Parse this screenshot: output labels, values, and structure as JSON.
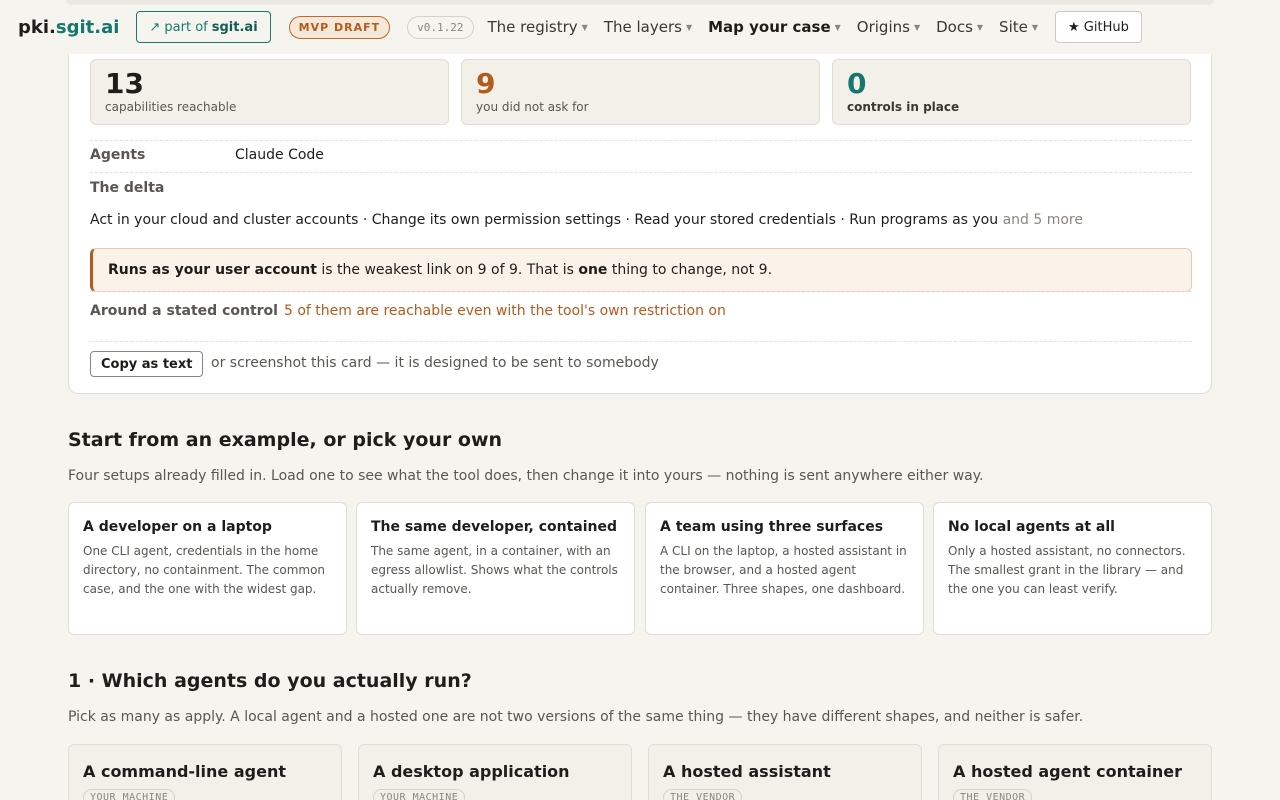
{
  "nav": {
    "brand_prefix": "pki.",
    "brand_domain": "sgit.ai",
    "partof_prefix": "↗ part of",
    "partof_site": "sgit.ai",
    "badge_status": "MVP DRAFT",
    "badge_version": "v0.1.22",
    "links": [
      "The registry",
      "The layers",
      "Map your case",
      "Origins",
      "Docs",
      "Site"
    ],
    "active_link": "Map your case",
    "github_label": "★ GitHub"
  },
  "result": {
    "stats": [
      {
        "value": "13",
        "label": "capabilities reachable",
        "color": "#1f1d1a"
      },
      {
        "value": "9",
        "label": "you did not ask for",
        "color": "#b45a1e"
      },
      {
        "value": "0",
        "label": "controls in place",
        "color": "#16786d"
      }
    ],
    "agents_label": "Agents",
    "agents_value": "Claude Code",
    "delta_label": "The delta",
    "delta_items": "Act in your cloud and cluster accounts · Change its own permission settings · Read your stored credentials · Run programs as you",
    "delta_more": "and 5 more",
    "callout": {
      "bold_lead": "Runs as your user account",
      "middle": "is the weakest link on 9 of 9. That is",
      "bold_one": "one",
      "tail": "thing to change, not 9."
    },
    "control_label": "Around a stated control",
    "control_value": "5 of them are reachable even with the tool's own restriction on",
    "copy_button": "Copy as text",
    "copy_hint": "or screenshot this card — it is designed to be sent to somebody"
  },
  "examples": {
    "title": "Start from an example, or pick your own",
    "lead": "Four setups already filled in. Load one to see what the tool does, then change it into yours — nothing is sent anywhere either way.",
    "cards": [
      {
        "title": "A developer on a laptop",
        "desc": "One CLI agent, credentials in the home directory, no containment. The common case, and the one with the widest gap."
      },
      {
        "title": "The same developer, contained",
        "desc": "The same agent, in a container, with an egress allowlist. Shows what the controls actually remove."
      },
      {
        "title": "A team using three surfaces",
        "desc": "A CLI on the laptop, a hosted assistant in the browser, and a hosted agent container. Three shapes, one dashboard."
      },
      {
        "title": "No local agents at all",
        "desc": "Only a hosted assistant, no connectors. The smallest grant in the library — and the one you can least verify."
      }
    ]
  },
  "step1": {
    "title": "1 · Which agents do you actually run?",
    "lead": "Pick as many as apply. A local agent and a hosted one are not two versions of the same thing — they have different shapes, and neither is safer.",
    "agents": [
      {
        "title": "A command-line agent",
        "tag": "YOUR MACHINE"
      },
      {
        "title": "A desktop application",
        "tag": "YOUR MACHINE"
      },
      {
        "title": "A hosted assistant",
        "tag": "THE VENDOR"
      },
      {
        "title": "A hosted agent container",
        "tag": "THE VENDOR"
      }
    ]
  }
}
